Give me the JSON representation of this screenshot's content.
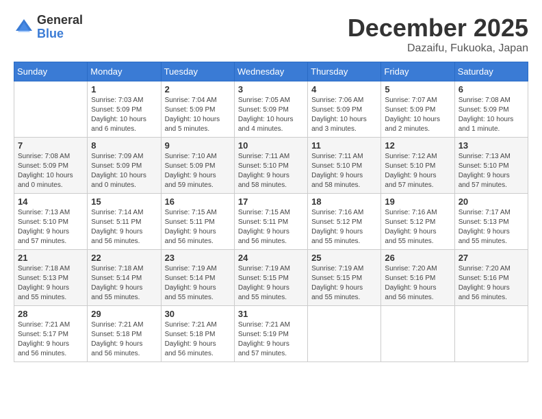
{
  "header": {
    "logo_general": "General",
    "logo_blue": "Blue",
    "title": "December 2025",
    "location": "Dazaifu, Fukuoka, Japan"
  },
  "days_of_week": [
    "Sunday",
    "Monday",
    "Tuesday",
    "Wednesday",
    "Thursday",
    "Friday",
    "Saturday"
  ],
  "weeks": [
    [
      {
        "day": "",
        "info": ""
      },
      {
        "day": "1",
        "info": "Sunrise: 7:03 AM\nSunset: 5:09 PM\nDaylight: 10 hours\nand 6 minutes."
      },
      {
        "day": "2",
        "info": "Sunrise: 7:04 AM\nSunset: 5:09 PM\nDaylight: 10 hours\nand 5 minutes."
      },
      {
        "day": "3",
        "info": "Sunrise: 7:05 AM\nSunset: 5:09 PM\nDaylight: 10 hours\nand 4 minutes."
      },
      {
        "day": "4",
        "info": "Sunrise: 7:06 AM\nSunset: 5:09 PM\nDaylight: 10 hours\nand 3 minutes."
      },
      {
        "day": "5",
        "info": "Sunrise: 7:07 AM\nSunset: 5:09 PM\nDaylight: 10 hours\nand 2 minutes."
      },
      {
        "day": "6",
        "info": "Sunrise: 7:08 AM\nSunset: 5:09 PM\nDaylight: 10 hours\nand 1 minute."
      }
    ],
    [
      {
        "day": "7",
        "info": "Sunrise: 7:08 AM\nSunset: 5:09 PM\nDaylight: 10 hours\nand 0 minutes."
      },
      {
        "day": "8",
        "info": "Sunrise: 7:09 AM\nSunset: 5:09 PM\nDaylight: 10 hours\nand 0 minutes."
      },
      {
        "day": "9",
        "info": "Sunrise: 7:10 AM\nSunset: 5:09 PM\nDaylight: 9 hours\nand 59 minutes."
      },
      {
        "day": "10",
        "info": "Sunrise: 7:11 AM\nSunset: 5:10 PM\nDaylight: 9 hours\nand 58 minutes."
      },
      {
        "day": "11",
        "info": "Sunrise: 7:11 AM\nSunset: 5:10 PM\nDaylight: 9 hours\nand 58 minutes."
      },
      {
        "day": "12",
        "info": "Sunrise: 7:12 AM\nSunset: 5:10 PM\nDaylight: 9 hours\nand 57 minutes."
      },
      {
        "day": "13",
        "info": "Sunrise: 7:13 AM\nSunset: 5:10 PM\nDaylight: 9 hours\nand 57 minutes."
      }
    ],
    [
      {
        "day": "14",
        "info": "Sunrise: 7:13 AM\nSunset: 5:10 PM\nDaylight: 9 hours\nand 57 minutes."
      },
      {
        "day": "15",
        "info": "Sunrise: 7:14 AM\nSunset: 5:11 PM\nDaylight: 9 hours\nand 56 minutes."
      },
      {
        "day": "16",
        "info": "Sunrise: 7:15 AM\nSunset: 5:11 PM\nDaylight: 9 hours\nand 56 minutes."
      },
      {
        "day": "17",
        "info": "Sunrise: 7:15 AM\nSunset: 5:11 PM\nDaylight: 9 hours\nand 56 minutes."
      },
      {
        "day": "18",
        "info": "Sunrise: 7:16 AM\nSunset: 5:12 PM\nDaylight: 9 hours\nand 55 minutes."
      },
      {
        "day": "19",
        "info": "Sunrise: 7:16 AM\nSunset: 5:12 PM\nDaylight: 9 hours\nand 55 minutes."
      },
      {
        "day": "20",
        "info": "Sunrise: 7:17 AM\nSunset: 5:13 PM\nDaylight: 9 hours\nand 55 minutes."
      }
    ],
    [
      {
        "day": "21",
        "info": "Sunrise: 7:18 AM\nSunset: 5:13 PM\nDaylight: 9 hours\nand 55 minutes."
      },
      {
        "day": "22",
        "info": "Sunrise: 7:18 AM\nSunset: 5:14 PM\nDaylight: 9 hours\nand 55 minutes."
      },
      {
        "day": "23",
        "info": "Sunrise: 7:19 AM\nSunset: 5:14 PM\nDaylight: 9 hours\nand 55 minutes."
      },
      {
        "day": "24",
        "info": "Sunrise: 7:19 AM\nSunset: 5:15 PM\nDaylight: 9 hours\nand 55 minutes."
      },
      {
        "day": "25",
        "info": "Sunrise: 7:19 AM\nSunset: 5:15 PM\nDaylight: 9 hours\nand 55 minutes."
      },
      {
        "day": "26",
        "info": "Sunrise: 7:20 AM\nSunset: 5:16 PM\nDaylight: 9 hours\nand 56 minutes."
      },
      {
        "day": "27",
        "info": "Sunrise: 7:20 AM\nSunset: 5:16 PM\nDaylight: 9 hours\nand 56 minutes."
      }
    ],
    [
      {
        "day": "28",
        "info": "Sunrise: 7:21 AM\nSunset: 5:17 PM\nDaylight: 9 hours\nand 56 minutes."
      },
      {
        "day": "29",
        "info": "Sunrise: 7:21 AM\nSunset: 5:18 PM\nDaylight: 9 hours\nand 56 minutes."
      },
      {
        "day": "30",
        "info": "Sunrise: 7:21 AM\nSunset: 5:18 PM\nDaylight: 9 hours\nand 56 minutes."
      },
      {
        "day": "31",
        "info": "Sunrise: 7:21 AM\nSunset: 5:19 PM\nDaylight: 9 hours\nand 57 minutes."
      },
      {
        "day": "",
        "info": ""
      },
      {
        "day": "",
        "info": ""
      },
      {
        "day": "",
        "info": ""
      }
    ]
  ]
}
